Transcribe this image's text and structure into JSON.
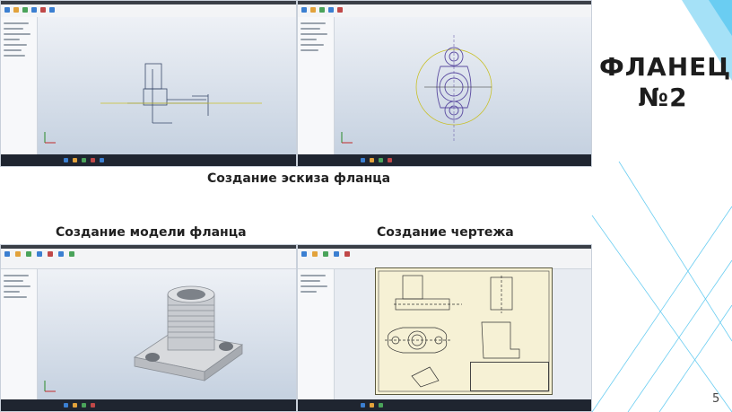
{
  "slide": {
    "title_line1": "ФЛАНЕЦ",
    "title_line2": "№2",
    "page_number": "5",
    "accent_color": "#5bc8f0"
  },
  "captions": {
    "sketch": "Создание эскиза фланца",
    "model": "Создание модели фланца",
    "drawing": "Создание чертежа"
  },
  "screenshots": [
    {
      "id": "sketch-front",
      "content": "flange sketch front view with dimensions"
    },
    {
      "id": "sketch-top",
      "content": "flange sketch top view with circles"
    },
    {
      "id": "model-3d",
      "content": "3D flange model with threaded boss"
    },
    {
      "id": "drawing-sheet",
      "content": "technical drawing of flange"
    }
  ],
  "icons": [
    "cad-ribbon-icon",
    "taskbar-app-icon"
  ]
}
